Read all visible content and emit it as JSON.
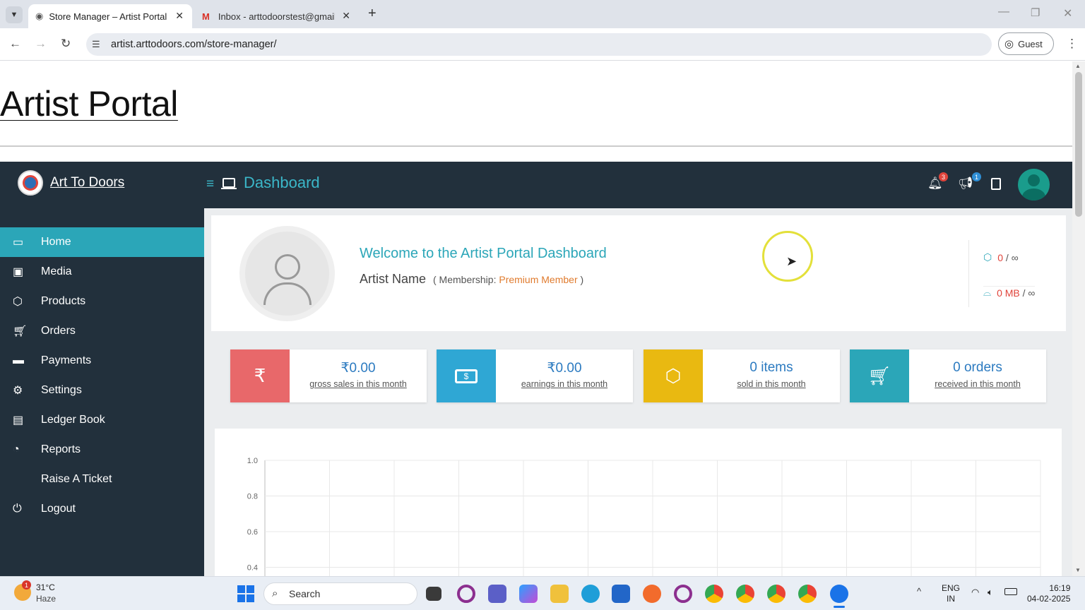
{
  "browser": {
    "tabs": [
      {
        "title": "Store Manager – Artist Portal",
        "active": true
      },
      {
        "title": "Inbox - arttodoorstest@gmail.c",
        "active": false
      }
    ],
    "url": "artist.arttodoors.com/store-manager/",
    "profile_label": "Guest"
  },
  "page": {
    "site_title": "Artist Portal",
    "brand": "Art To Doors",
    "header_title": "Dashboard",
    "notifications_count": "3",
    "announcements_count": "1"
  },
  "sidebar": {
    "items": [
      {
        "label": "Home",
        "icon": "monitor-icon",
        "active": true
      },
      {
        "label": "Media",
        "icon": "image-icon"
      },
      {
        "label": "Products",
        "icon": "cube-icon"
      },
      {
        "label": "Orders",
        "icon": "cart-icon"
      },
      {
        "label": "Payments",
        "icon": "credit-card-icon"
      },
      {
        "label": "Settings",
        "icon": "gears-icon"
      },
      {
        "label": "Ledger Book",
        "icon": "money-icon"
      },
      {
        "label": "Reports",
        "icon": "pie-chart-icon"
      },
      {
        "label": "Raise A Ticket",
        "icon": ""
      },
      {
        "label": "Logout",
        "icon": "power-icon"
      }
    ]
  },
  "welcome": {
    "heading": "Welcome to the Artist Portal Dashboard",
    "artist_name": "Artist Name",
    "membership_prefix": "( Membership:",
    "membership_level": "Premium Member",
    "membership_suffix": ")",
    "product_limit": "0",
    "product_limit_max": "/ ∞",
    "storage_limit": "0 MB",
    "storage_limit_max": "/ ∞"
  },
  "stats": [
    {
      "value": "₹0.00",
      "label": "gross sales in this month",
      "color": "#e8686a",
      "icon": "rupee-icon"
    },
    {
      "value": "₹0.00",
      "label": "earnings in this month",
      "color": "#2fa7d4",
      "icon": "money-icon"
    },
    {
      "value": "0 items",
      "label": "sold in this month",
      "color": "#e9b911",
      "icon": "cube-icon"
    },
    {
      "value": "0 orders",
      "label": "received in this month",
      "color": "#2ba6b8",
      "icon": "cart-plus-icon"
    }
  ],
  "chart_data": {
    "type": "line",
    "y_ticks": [
      "1.0",
      "0.8",
      "0.6",
      "0.4"
    ],
    "ylim": [
      0.4,
      1.0
    ],
    "series": [],
    "grid": true
  },
  "taskbar": {
    "weather_temp": "31°C",
    "weather_condition": "Haze",
    "weather_badge": "1",
    "search_placeholder": "Search",
    "lang_1": "ENG",
    "lang_2": "IN",
    "time": "16:19",
    "date": "04-02-2025"
  },
  "colors": {
    "sidebar_bg": "#22303c",
    "accent": "#2ba6b8",
    "premium": "#e07b2e"
  }
}
